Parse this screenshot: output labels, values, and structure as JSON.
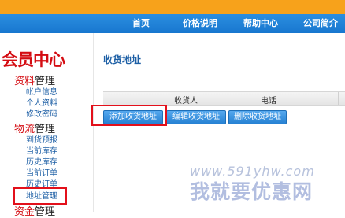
{
  "nav": {
    "items": [
      "首页",
      "价格说明",
      "帮助中心",
      "公司简介"
    ]
  },
  "sidebar": {
    "logo": "会员中心",
    "sections": [
      {
        "title_main": "资料",
        "title_tail": "管理",
        "items": [
          "帐户信息",
          "个人资料",
          "修改密码"
        ]
      },
      {
        "title_main": "物流",
        "title_tail": "管理",
        "items": [
          "到货预报",
          "当前库存",
          "历史库存",
          "当前订单",
          "历史订单",
          "地址管理"
        ]
      },
      {
        "title_main": "资金",
        "title_tail": "管理",
        "items": []
      }
    ]
  },
  "main": {
    "title": "收货地址",
    "table": {
      "headers": [
        "收货人",
        "电话"
      ]
    },
    "buttons": {
      "add": "添加收货地址",
      "edit": "编辑收货地址",
      "delete": "删除收货地址"
    }
  },
  "watermark": {
    "url": "www.591yhw.com",
    "name": "我就要优惠网"
  },
  "colors": {
    "nav_bg": "#1877cf",
    "top_bar": "#f7a21b",
    "accent_red": "#d40c12",
    "link_blue": "#1d5fa5",
    "highlight": "#e3101b"
  }
}
